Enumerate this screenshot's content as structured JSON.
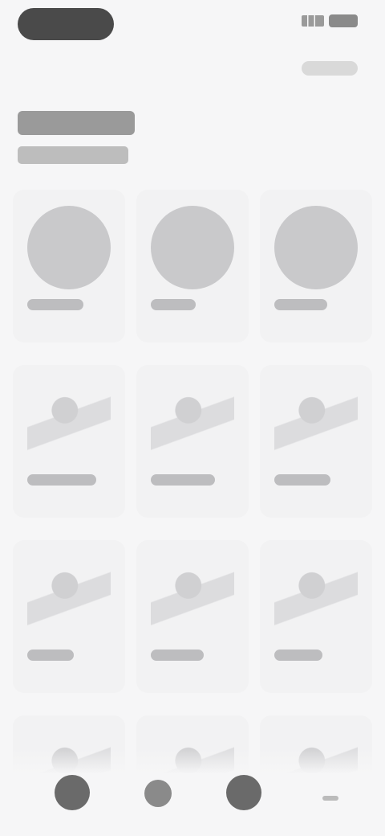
{
  "status_bar": {
    "indicator": "pill-indicator",
    "signal_icon": "signal-icon",
    "battery_icon": "battery-icon"
  },
  "top_action": {
    "icon": "action-pill"
  },
  "header": {
    "title": "",
    "subtitle": ""
  },
  "tiles": [
    {
      "art": "circle",
      "label": ""
    },
    {
      "art": "circle",
      "label": ""
    },
    {
      "art": "circle",
      "label": ""
    },
    {
      "art": "sketch",
      "label": ""
    },
    {
      "art": "sketch",
      "label": ""
    },
    {
      "art": "sketch",
      "label": ""
    },
    {
      "art": "sketch",
      "label": ""
    },
    {
      "art": "sketch",
      "label": ""
    },
    {
      "art": "sketch",
      "label": ""
    },
    {
      "art": "sketch",
      "label": ""
    },
    {
      "art": "sketch",
      "label": ""
    },
    {
      "art": "sketch",
      "label": ""
    }
  ],
  "bottom_nav": [
    {
      "name": "nav-home-icon"
    },
    {
      "name": "nav-explore-icon"
    },
    {
      "name": "nav-profile-icon"
    },
    {
      "name": "nav-more-icon"
    }
  ],
  "colors": {
    "background": "#f6f6f7",
    "tile": "#f2f2f3",
    "dark": "#4a4a4a"
  }
}
